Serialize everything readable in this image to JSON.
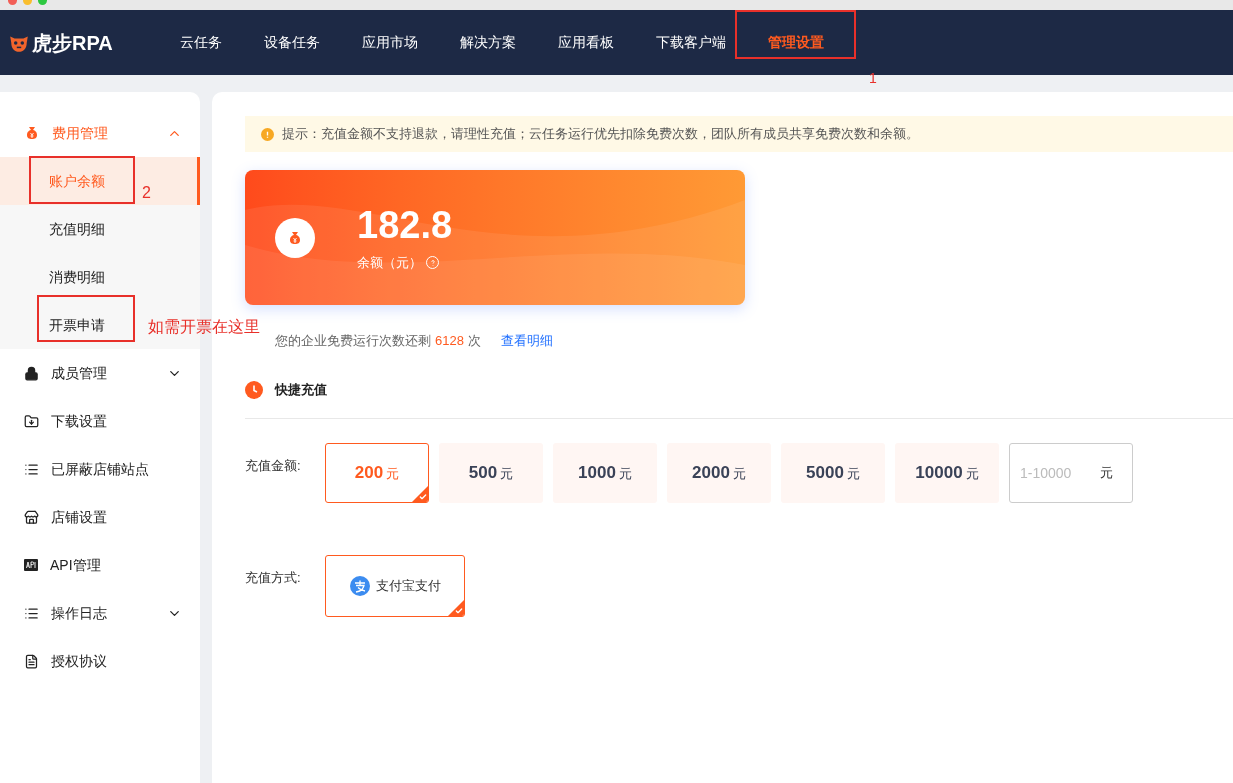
{
  "logo": {
    "text": "虎步RPA"
  },
  "nav": [
    {
      "label": "云任务",
      "selected": false
    },
    {
      "label": "设备任务",
      "selected": false
    },
    {
      "label": "应用市场",
      "selected": false
    },
    {
      "label": "解决方案",
      "selected": false
    },
    {
      "label": "应用看板",
      "selected": false
    },
    {
      "label": "下载客户端",
      "selected": false
    },
    {
      "label": "管理设置",
      "selected": true
    }
  ],
  "sidebar": [
    {
      "label": "费用管理",
      "kind": "group",
      "expanded": true,
      "selected": true,
      "children": [
        {
          "label": "账户余额",
          "selected": true
        },
        {
          "label": "充值明细",
          "selected": false
        },
        {
          "label": "消费明细",
          "selected": false
        },
        {
          "label": "开票申请",
          "selected": false
        }
      ]
    },
    {
      "label": "成员管理",
      "kind": "group",
      "expanded": false,
      "selected": false
    },
    {
      "label": "下载设置",
      "kind": "item",
      "selected": false
    },
    {
      "label": "已屏蔽店铺站点",
      "kind": "item",
      "selected": false
    },
    {
      "label": "店铺设置",
      "kind": "item",
      "selected": false
    },
    {
      "label": "API管理",
      "kind": "item",
      "selected": false
    },
    {
      "label": "操作日志",
      "kind": "group",
      "expanded": false,
      "selected": false
    },
    {
      "label": "授权协议",
      "kind": "item",
      "selected": false
    }
  ],
  "notice": "提示：充值金额不支持退款，请理性充值；云任务运行优先扣除免费次数，团队所有成员共享免费次数和余额。",
  "balance": {
    "value": "182.8",
    "label": "余额（元）"
  },
  "free_runs": {
    "prefix": "您的企业免费运行次数还剩",
    "count": "6128",
    "suffix": "次",
    "link": "查看明细"
  },
  "quick_recharge": {
    "title": "快捷充值",
    "amount_label": "充值金额:",
    "amounts": [
      {
        "value": "200",
        "unit": "元",
        "selected": true
      },
      {
        "value": "500",
        "unit": "元",
        "selected": false
      },
      {
        "value": "1000",
        "unit": "元",
        "selected": false
      },
      {
        "value": "2000",
        "unit": "元",
        "selected": false
      },
      {
        "value": "5000",
        "unit": "元",
        "selected": false
      },
      {
        "value": "10000",
        "unit": "元",
        "selected": false
      }
    ],
    "custom": {
      "placeholder": "1-10000",
      "unit": "元"
    },
    "method_label": "充值方式:",
    "methods": [
      {
        "label": "支付宝支付",
        "selected": true
      }
    ]
  },
  "annotations": [
    {
      "text": "1"
    },
    {
      "text": "2"
    },
    {
      "text": "如需开票在这里"
    }
  ]
}
